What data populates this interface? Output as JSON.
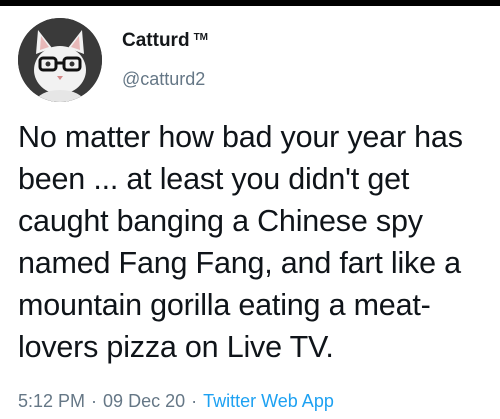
{
  "author": {
    "display_name": "Catturd",
    "tm": "TM",
    "handle": "@catturd2",
    "avatar_icon": "cat-with-glasses-avatar"
  },
  "tweet": {
    "text": "No matter how bad your year has been ... at least you didn't get caught banging a Chinese spy named Fang Fang, and fart like a mountain gorilla eating a meat-lovers pizza on Live TV."
  },
  "meta": {
    "time": "5:12 PM",
    "separator": "·",
    "date": "09 Dec 20",
    "source": "Twitter Web App"
  },
  "colors": {
    "text": "#0f1419",
    "secondary": "#657786",
    "link": "#1da1f2"
  }
}
